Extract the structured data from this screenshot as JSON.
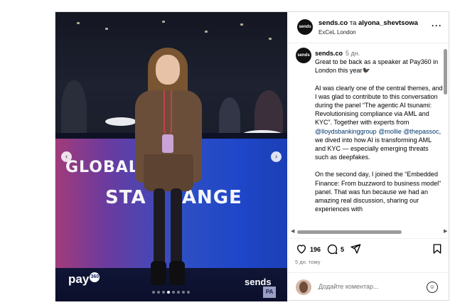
{
  "post": {
    "header": {
      "author": "sends.co",
      "connector": "та",
      "coauthor": "alyona_shevtsowa",
      "location": "ExCeL London",
      "avatar_text": "sends"
    },
    "media": {
      "banner_line1": "GLOBAL EX",
      "banner_line2": "STA     ANGE",
      "pay_logo": "pay",
      "pay_badge": "360",
      "sends_logo": "sends",
      "pa_logo": "PA",
      "slide_count": 8,
      "active_slide": 4
    },
    "caption": {
      "user": "sends.co",
      "time": "5 дн.",
      "p1": "Great to be back as a speaker at Pay360 in London this year🐦‍⬛",
      "p2_a": "AI was clearly one of the central themes, and I was glad to contribute to this conversation during the panel “The agentic AI tsunami: Revolutionising compliance via AML and KYC”. Together with experts from ",
      "mention1": "@lloydsbankinggroup",
      "mention2": "@mollie",
      "mention3": "@thepassoc",
      "p2_b": ", we dived into how AI is transforming AML and KYC — especially emerging threats such as deepfakes.",
      "p3": "On the second day, I joined the “Embedded Finance: From buzzword to business model” panel. That was fun because we had an amazing real discussion, sharing our experiences with"
    },
    "actions": {
      "likes": "196",
      "comments": "5",
      "posted_ago": "5 дн. тому"
    },
    "comment_box": {
      "placeholder": "Додайте коментар..."
    }
  }
}
